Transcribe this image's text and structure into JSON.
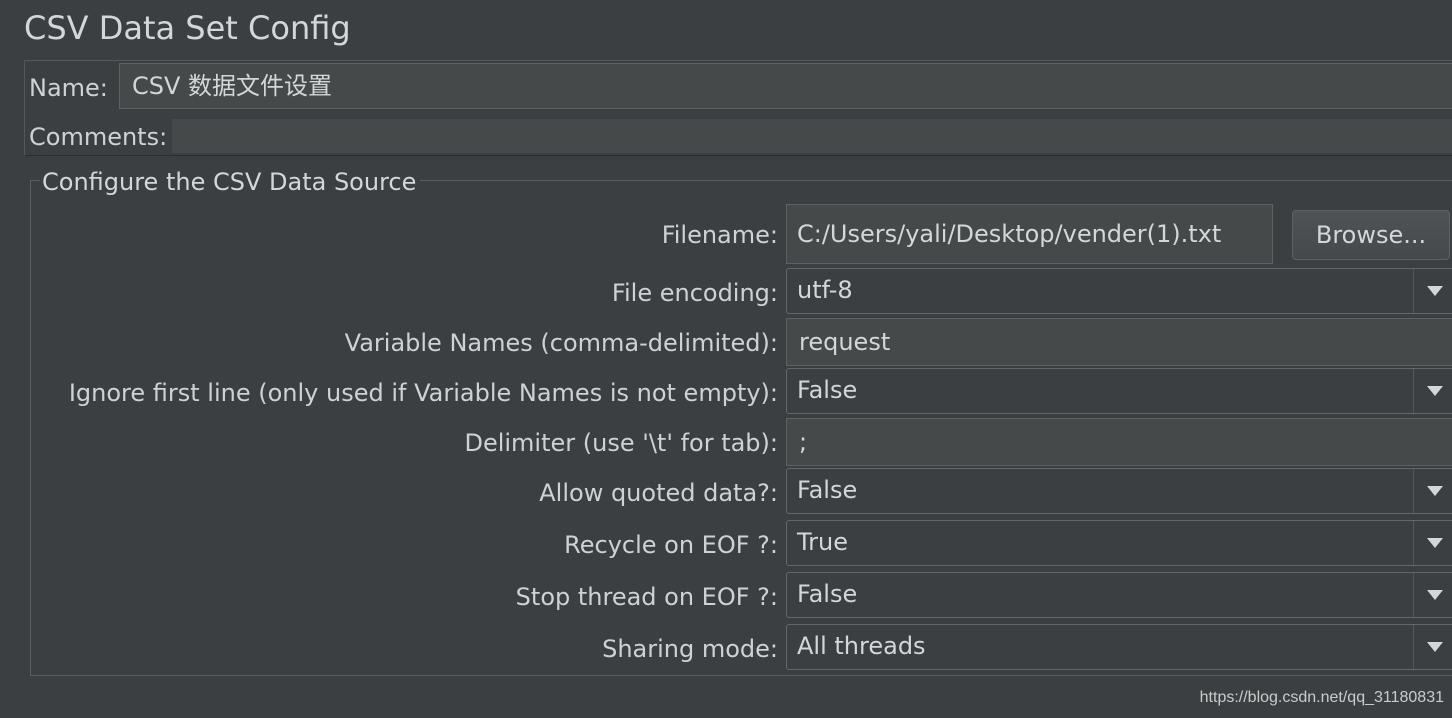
{
  "title": "CSV Data Set Config",
  "name": {
    "label": "Name:",
    "value": "CSV 数据文件设置"
  },
  "comments": {
    "label": "Comments:",
    "value": ""
  },
  "section_title": "Configure the CSV Data Source",
  "filename": {
    "label": "Filename:",
    "value": "C:/Users/yali/Desktop/vender(1).txt",
    "browse_label": "Browse..."
  },
  "file_encoding": {
    "label": "File encoding:",
    "value": "utf-8"
  },
  "variable_names": {
    "label": "Variable Names (comma-delimited):",
    "value": "request"
  },
  "ignore_first_line": {
    "label": "Ignore first line (only used if Variable Names is not empty):",
    "value": "False"
  },
  "delimiter": {
    "label": "Delimiter (use '\\t' for tab):",
    "value": ";"
  },
  "allow_quoted": {
    "label": "Allow quoted data?:",
    "value": "False"
  },
  "recycle_eof": {
    "label": "Recycle on EOF ?:",
    "value": "True"
  },
  "stop_thread_eof": {
    "label": "Stop thread on EOF ?:",
    "value": "False"
  },
  "sharing_mode": {
    "label": "Sharing mode:",
    "value": "All threads"
  },
  "watermark": "https://blog.csdn.net/qq_31180831",
  "icons": {
    "dropdown": "chevron-down-icon"
  }
}
